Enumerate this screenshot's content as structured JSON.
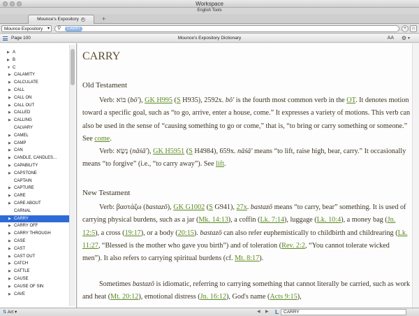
{
  "window": {
    "title": "Workspace",
    "subtitle": "English Tools"
  },
  "tabs": [
    {
      "label": "Mounce's Expository"
    }
  ],
  "toolbar": {
    "library": "Mounce Expository",
    "search_token": "CARRY"
  },
  "pane": {
    "page": "Page 100",
    "title": "Mounce's Expository Dictionary",
    "font_button": "AA"
  },
  "sidebar": {
    "items": [
      {
        "label": "A",
        "level": 0,
        "arrow": "▶"
      },
      {
        "label": "B",
        "level": 0,
        "arrow": "▶"
      },
      {
        "label": "C",
        "level": 0,
        "arrow": "▼"
      },
      {
        "label": "CALAMITY",
        "level": 1,
        "arrow": "▶"
      },
      {
        "label": "CALCULATE",
        "level": 1,
        "arrow": "▶"
      },
      {
        "label": "CALL",
        "level": 1,
        "arrow": "▶"
      },
      {
        "label": "CALL ON",
        "level": 1,
        "arrow": "▶"
      },
      {
        "label": "CALL OUT",
        "level": 1,
        "arrow": "▶"
      },
      {
        "label": "CALLED",
        "level": 1,
        "arrow": "▶"
      },
      {
        "label": "CALLING",
        "level": 1,
        "arrow": "▶"
      },
      {
        "label": "CALVARY",
        "level": 1,
        "arrow": ""
      },
      {
        "label": "CAMEL",
        "level": 1,
        "arrow": "▶"
      },
      {
        "label": "CAMP",
        "level": 1,
        "arrow": "▶"
      },
      {
        "label": "CAN",
        "level": 1,
        "arrow": "▶"
      },
      {
        "label": "CANDLE, CANDLES...",
        "level": 1,
        "arrow": "▶"
      },
      {
        "label": "CAPABILITY",
        "level": 1,
        "arrow": "▶"
      },
      {
        "label": "CAPSTONE",
        "level": 1,
        "arrow": "▶"
      },
      {
        "label": "CAPTAIN",
        "level": 1,
        "arrow": ""
      },
      {
        "label": "CAPTURE",
        "level": 1,
        "arrow": "▶"
      },
      {
        "label": "CARE",
        "level": 1,
        "arrow": "▶"
      },
      {
        "label": "CARE ABOUT",
        "level": 1,
        "arrow": "▶"
      },
      {
        "label": "CARNAL",
        "level": 1,
        "arrow": ""
      },
      {
        "label": "CARRY",
        "level": 1,
        "arrow": "▶",
        "selected": true
      },
      {
        "label": "CARRY OFF",
        "level": 1,
        "arrow": "▶"
      },
      {
        "label": "CARRY THROUGH",
        "level": 1,
        "arrow": "▶"
      },
      {
        "label": "CASE",
        "level": 1,
        "arrow": "▶"
      },
      {
        "label": "CAST",
        "level": 1,
        "arrow": "▶"
      },
      {
        "label": "CAST OUT",
        "level": 1,
        "arrow": "▶"
      },
      {
        "label": "CATCH",
        "level": 1,
        "arrow": "▶"
      },
      {
        "label": "CATTLE",
        "level": 1,
        "arrow": "▶"
      },
      {
        "label": "CAUSE",
        "level": 1,
        "arrow": "▶"
      },
      {
        "label": "CAUSE OF SIN",
        "level": 1,
        "arrow": "▶"
      },
      {
        "label": "CAVE",
        "level": 1,
        "arrow": "▶"
      }
    ]
  },
  "article": {
    "title": "CARRY",
    "ot_heading": "Old Testament",
    "nt_heading": "New Testament",
    "ot_p1": {
      "a": "Verb: ",
      "heb": "בּוֹא",
      "b": " (",
      "translit": "bô'",
      "c": "), ",
      "gk": "GK H995",
      "d": " (",
      "s": "S",
      "e": " H935), 2592x. ",
      "translit2": "bô'",
      "f": " is the fourth most common verb in the ",
      "ot": "OT",
      "g": ". It denotes motion toward a specific goal, such as “to go, arrive, enter a house, come.” It expresses a variety of motions. This verb can also be used in the sense of “causing something to go or come,” that is, “to bring or carry something or someone.” See ",
      "see": "come",
      "h": "."
    },
    "ot_p2": {
      "a": "Verb: ",
      "heb": "נָשָׂא",
      "b": " (",
      "translit": "nāśā'",
      "c": "), ",
      "gk": "GK H5951",
      "d": " (",
      "s": "S",
      "e": " H4984), 659x. ",
      "translit2": "nāśā'",
      "f": " means “to lift, raise high, bear, carry.” It occasionally means “to forgive” (i.e., “to carry away”). See ",
      "see": "lift",
      "g": "."
    },
    "nt_p1": {
      "a": "Verb: ",
      "greek": "βαστάζω",
      "b": " (",
      "translit": "bastazō",
      "c": "), ",
      "gk": "GK G1002",
      "d": " (",
      "s": "S",
      "e": " G941), ",
      "count": "27x",
      "f": ". ",
      "translit2": "bastazō",
      "g": " means “to carry, bear” something. It is used of carrying physical burdens, such as a jar (",
      "r1": "Mk. 14:13",
      "h": "), a coffin (",
      "r2": "Lk. 7:14",
      "i": "), luggage (",
      "r3": "Lk. 10:4",
      "j": "), a money bag (",
      "r4": "Jn. 12:5",
      "k": "), a cross (",
      "r5": "19:17",
      "l": "), or a body (",
      "r6": "20:15",
      "m": "). ",
      "translit3": "bastazō",
      "n": " can also refer euphemistically to childbirth and childrearing (",
      "r7": "Lk. 11:27",
      "o": ", “Blessed is the mother who gave you birth”) and of toleration (",
      "r8": "Rev. 2:2",
      "p": ", “You cannot tolerate wicked men”). It also refers to carrying spiritual burdens (cf. ",
      "r9": "Mt. 8:17",
      "q": ")."
    },
    "nt_p2": {
      "a": "Sometimes ",
      "translit": "bastazō",
      "b": " is idiomatic, referring to carrying something that cannot literally be carried, such as work and heat (",
      "r1": "Mt. 20:12",
      "c": "), emotional distress (",
      "r2": "Jn. 16:12",
      "d": "), God's name (",
      "r3": "Acts 9:15",
      "e": "),"
    }
  },
  "status": {
    "resource": "Art",
    "reference": "CARRY",
    "L": "L"
  },
  "colors": {
    "selection": "#2f6bd6",
    "link": "#5a8a1e",
    "text": "#3b3321"
  }
}
